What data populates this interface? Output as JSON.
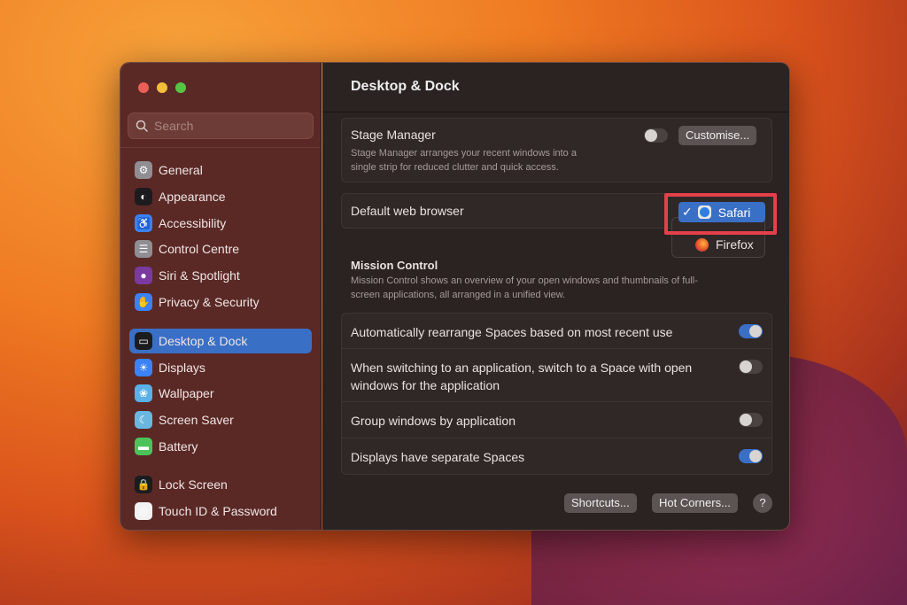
{
  "window": {
    "title": "Desktop & Dock"
  },
  "sidebar": {
    "search_placeholder": "Search",
    "items": [
      {
        "label": "General",
        "color": "#8e8e93",
        "glyph": "⚙"
      },
      {
        "label": "Appearance",
        "color": "#1c1c1e",
        "glyph": "◐"
      },
      {
        "label": "Accessibility",
        "color": "#3a82f6",
        "glyph": "♿"
      },
      {
        "label": "Control Centre",
        "color": "#8e8e93",
        "glyph": "☰"
      },
      {
        "label": "Siri & Spotlight",
        "color": "#7a3aa0",
        "glyph": "●"
      },
      {
        "label": "Privacy & Security",
        "color": "#3a82f6",
        "glyph": "✋"
      },
      {
        "label": "Desktop & Dock",
        "color": "#1c1c1e",
        "glyph": "▭"
      },
      {
        "label": "Displays",
        "color": "#3a82f6",
        "glyph": "☀"
      },
      {
        "label": "Wallpaper",
        "color": "#5ab0e8",
        "glyph": "❀"
      },
      {
        "label": "Screen Saver",
        "color": "#6ab8e0",
        "glyph": "☾"
      },
      {
        "label": "Battery",
        "color": "#4cc35a",
        "glyph": "▬"
      },
      {
        "label": "Lock Screen",
        "color": "#1c1c1e",
        "glyph": "🔒"
      },
      {
        "label": "Touch ID & Password",
        "color": "#f2f2f2",
        "glyph": "◎"
      }
    ]
  },
  "stage": {
    "title": "Stage Manager",
    "desc1": "Stage Manager arranges your recent windows into a",
    "desc2": "single strip for reduced clutter and quick access.",
    "button": "Customise..."
  },
  "browser": {
    "label": "Default web browser",
    "options": [
      {
        "label": "Safari",
        "selected": true,
        "check": "✓"
      },
      {
        "label": "Firefox",
        "selected": false
      }
    ]
  },
  "mission": {
    "title": "Mission Control",
    "desc1": "Mission Control shows an overview of your open windows and thumbnails of full-",
    "desc2": "screen applications, all arranged in a unified view.",
    "rows": [
      {
        "l1": "Automatically rearrange Spaces based on most recent use",
        "l2": "",
        "on": true
      },
      {
        "l1": "When switching to an application, switch to a Space with open",
        "l2": "windows for the application",
        "on": false
      },
      {
        "l1": "Group windows by application",
        "l2": "",
        "on": false
      },
      {
        "l1": "Displays have separate Spaces",
        "l2": "",
        "on": true
      }
    ]
  },
  "footer": {
    "shortcuts": "Shortcuts...",
    "hot_corners": "Hot Corners...",
    "help": "?"
  },
  "highlight_color": "#e5404a"
}
